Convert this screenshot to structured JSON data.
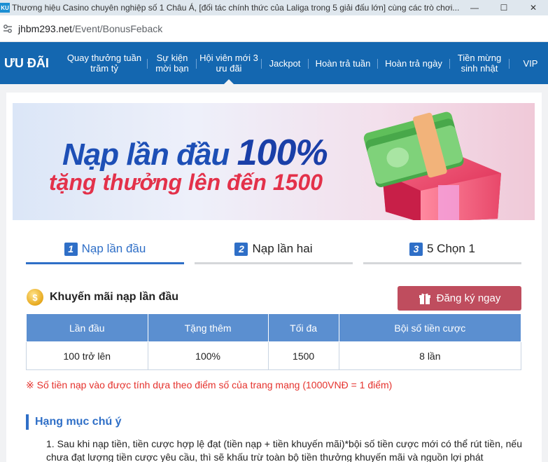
{
  "window": {
    "app_icon": "KU",
    "title": "Thương hiệu Casino chuyên nghiệp số 1 Châu Á, [đối tác chính thức của Laliga trong 5 giải đấu lớn] cùng các trò chơi...",
    "minimize": "—",
    "maximize": "☐",
    "close": "✕"
  },
  "address": {
    "domain": "jhbm293.net",
    "path": "/Event/BonusFeback"
  },
  "nav": {
    "brand": "ƯU ĐÃI",
    "items": [
      {
        "label": "Quay thưởng tuần trăm tỷ"
      },
      {
        "label": "Sự kiện mời bạn"
      },
      {
        "label": "Hội viên mới 3 ưu đãi"
      },
      {
        "label": "Jackpot"
      },
      {
        "label": "Hoàn trả tuần"
      },
      {
        "label": "Hoàn trả ngày"
      },
      {
        "label": "Tiền mừng sinh nhật"
      },
      {
        "label": "VIP"
      }
    ]
  },
  "banner": {
    "line1_text": "Nạp lần đầu",
    "line1_big": "100%",
    "line2": "tặng thưởng lên đến 1500"
  },
  "tabs": [
    {
      "num": "1",
      "label": "Nạp lần đầu",
      "active": true
    },
    {
      "num": "2",
      "label": "Nạp lần hai",
      "active": false
    },
    {
      "num": "3",
      "label": "5 Chọn 1",
      "active": false
    }
  ],
  "promo": {
    "coin_symbol": "$",
    "title": "Khuyến mãi nạp lần đầu",
    "register_label": "Đăng ký ngay",
    "table": {
      "headers": [
        "Lần đầu",
        "Tặng thêm",
        "Tối đa",
        "Bội số tiền cược"
      ],
      "rows": [
        [
          "100 trở lên",
          "100%",
          "1500",
          "8 lần"
        ]
      ]
    },
    "note": "※ Số tiền nạp vào được tính dựa theo điểm số của trang mạng (1000VNĐ = 1 điểm)"
  },
  "notice": {
    "heading": "Hạng mục chú ý",
    "item1": "1. Sau khi nạp tiền, tiền cược hợp lệ đạt (tiền nạp + tiền khuyến mãi)*bội số tiền cược mới có thể rút tiền, nếu chưa đạt lượng tiền cược yêu cầu, thì sẽ khấu trừ toàn bộ tiền thưởng khuyến mãi và nguồn lợi phát"
  },
  "colors": {
    "nav_bg": "#1467b0",
    "accent": "#2f6fc7",
    "register_btn": "#bf4d5e",
    "table_header": "#5b8fd0",
    "note": "#e5322d"
  }
}
